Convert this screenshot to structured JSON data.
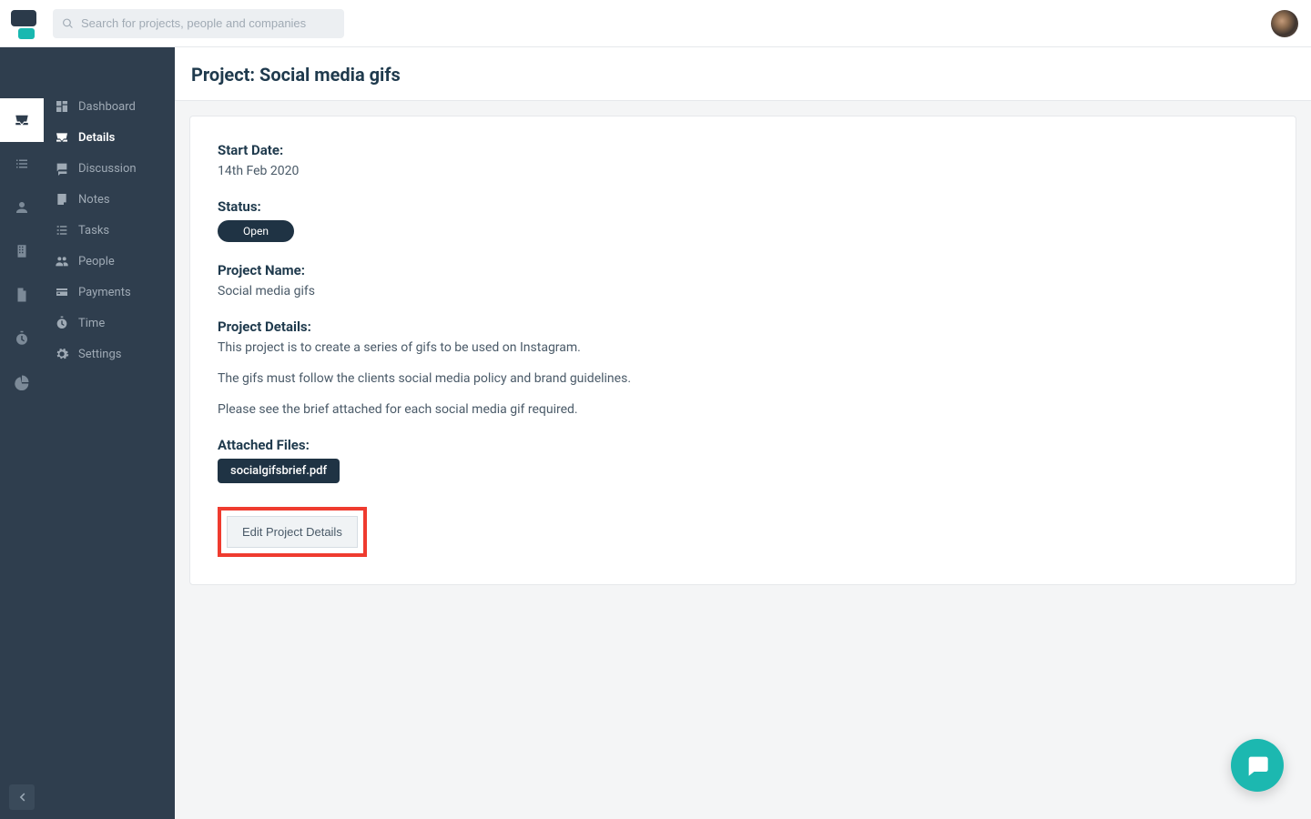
{
  "search": {
    "placeholder": "Search for projects, people and companies"
  },
  "page": {
    "title": "Project: Social media gifs"
  },
  "sidebar": {
    "items": [
      {
        "label": "Dashboard"
      },
      {
        "label": "Details"
      },
      {
        "label": "Discussion"
      },
      {
        "label": "Notes"
      },
      {
        "label": "Tasks"
      },
      {
        "label": "People"
      },
      {
        "label": "Payments"
      },
      {
        "label": "Time"
      },
      {
        "label": "Settings"
      }
    ]
  },
  "details": {
    "start_date_label": "Start Date:",
    "start_date_value": "14th Feb 2020",
    "status_label": "Status:",
    "status_value": "Open",
    "project_name_label": "Project Name:",
    "project_name_value": "Social media gifs",
    "project_details_label": "Project Details:",
    "project_details_p1": "This project is to create a series of gifs to be used on Instagram.",
    "project_details_p2": "The gifs must follow the clients social media policy and brand guidelines.",
    "project_details_p3": "Please see the brief attached for each social media gif required.",
    "attached_files_label": "Attached Files:",
    "attached_file_name": "socialgifsbrief.pdf",
    "edit_button_label": "Edit Project Details"
  }
}
